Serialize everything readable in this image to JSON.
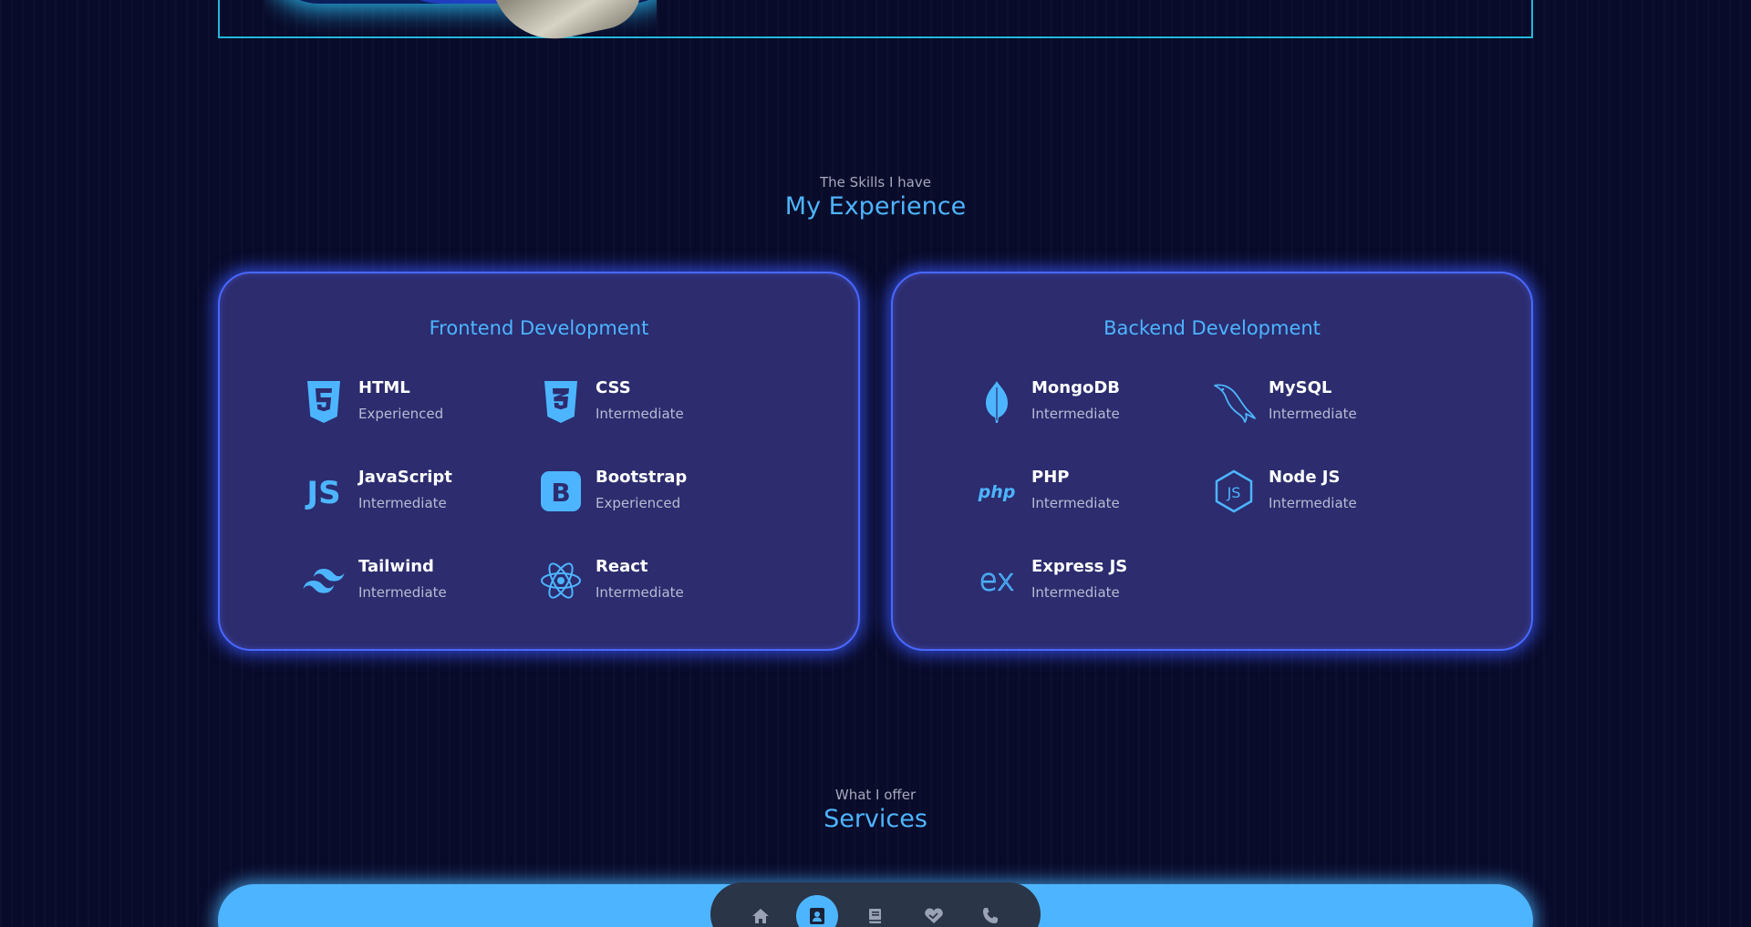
{
  "colors": {
    "background": "#090b2a",
    "accent": "#4db5ff",
    "card": "#2c2c6e",
    "card_border": "#4968ff",
    "frame_line": "#23b6d9",
    "dock": "#2b3548"
  },
  "experience": {
    "subtitle": "The Skills I have",
    "title": "My Experience",
    "frontend": {
      "title": "Frontend Development",
      "skills": [
        {
          "name": "HTML",
          "level": "Experienced",
          "icon": "html5-icon"
        },
        {
          "name": "CSS",
          "level": "Intermediate",
          "icon": "css3-icon"
        },
        {
          "name": "JavaScript",
          "level": "Intermediate",
          "icon": "javascript-icon"
        },
        {
          "name": "Bootstrap",
          "level": "Experienced",
          "icon": "bootstrap-icon"
        },
        {
          "name": "Tailwind",
          "level": "Intermediate",
          "icon": "tailwind-icon"
        },
        {
          "name": "React",
          "level": "Intermediate",
          "icon": "react-icon"
        }
      ]
    },
    "backend": {
      "title": "Backend Development",
      "skills": [
        {
          "name": "MongoDB",
          "level": "Intermediate",
          "icon": "mongodb-icon"
        },
        {
          "name": "MySQL",
          "level": "Intermediate",
          "icon": "mysql-icon"
        },
        {
          "name": "PHP",
          "level": "Intermediate",
          "icon": "php-icon"
        },
        {
          "name": "Node JS",
          "level": "Intermediate",
          "icon": "nodejs-icon"
        },
        {
          "name": "Express JS",
          "level": "Intermediate",
          "icon": "express-icon"
        }
      ]
    }
  },
  "services": {
    "subtitle": "What I offer",
    "title": "Services"
  },
  "dock": {
    "items": [
      {
        "icon": "home-icon",
        "active": false
      },
      {
        "icon": "user-icon",
        "active": true
      },
      {
        "icon": "book-icon",
        "active": false
      },
      {
        "icon": "handshake-icon",
        "active": false
      },
      {
        "icon": "phone-icon",
        "active": false
      }
    ]
  }
}
